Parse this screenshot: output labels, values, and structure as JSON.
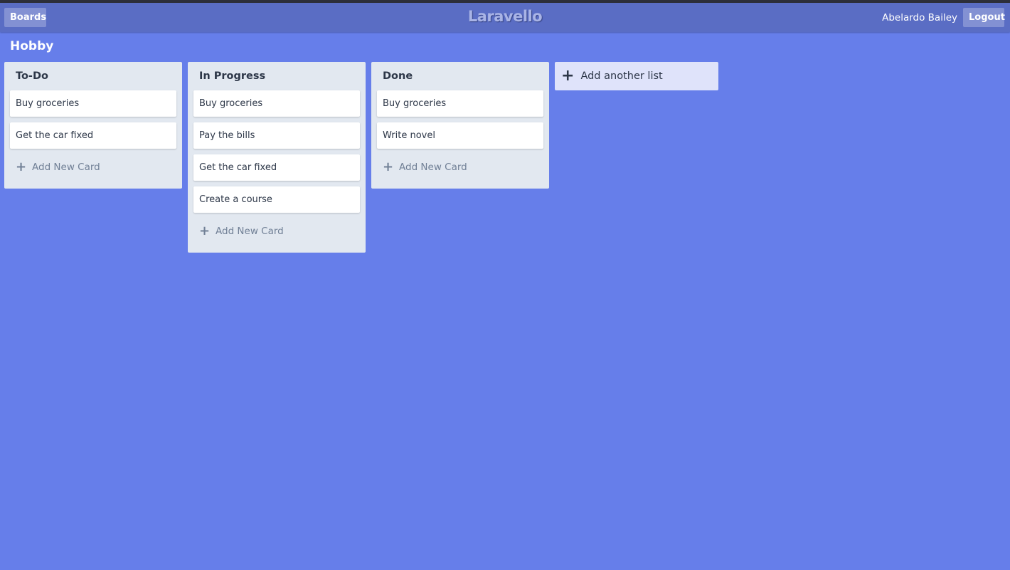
{
  "header": {
    "boards_label": "Boards",
    "brand": "Laravello",
    "user_name": "Abelardo Bailey",
    "logout_label": "Logout"
  },
  "board": {
    "title": "Hobby",
    "lists": [
      {
        "title": "To-Do",
        "cards": [
          "Buy groceries",
          "Get the car fixed"
        ],
        "add_card_label": "Add New Card"
      },
      {
        "title": "In Progress",
        "cards": [
          "Buy groceries",
          "Pay the bills",
          "Get the car fixed",
          "Create a course"
        ],
        "add_card_label": "Add New Card"
      },
      {
        "title": "Done",
        "cards": [
          "Buy groceries",
          "Write novel"
        ],
        "add_card_label": "Add New Card"
      }
    ],
    "add_list_label": "Add another list"
  },
  "icons": {
    "plus": "plus-icon"
  },
  "colors": {
    "background": "#667eea",
    "header": "#5a6dc4",
    "list": "#e2e8f0",
    "add_list": "#dfe3fa"
  }
}
